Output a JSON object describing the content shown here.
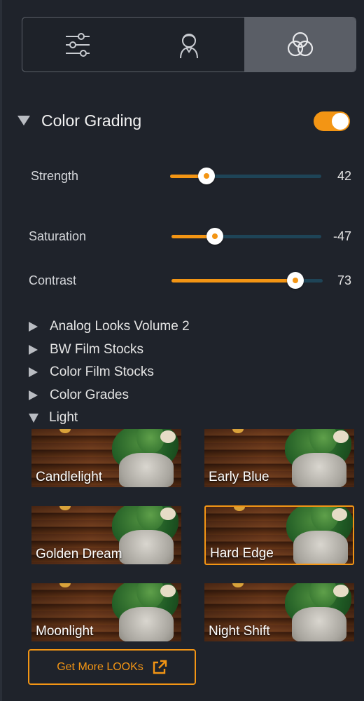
{
  "tabs": [
    {
      "icon": "sliders-icon",
      "active": false
    },
    {
      "icon": "portrait-icon",
      "active": false
    },
    {
      "icon": "color-circles-icon",
      "active": true
    }
  ],
  "section": {
    "title": "Color Grading",
    "enabled": true
  },
  "sliders": [
    {
      "label": "Strength",
      "value": "42",
      "fraction": 0.24
    },
    {
      "label": "Saturation",
      "value": "-47",
      "fraction": 0.29
    },
    {
      "label": "Contrast",
      "value": "73",
      "fraction": 0.82
    }
  ],
  "categories": [
    {
      "label": "Analog Looks Volume 2",
      "expanded": false
    },
    {
      "label": "BW Film Stocks",
      "expanded": false
    },
    {
      "label": "Color Film Stocks",
      "expanded": false
    },
    {
      "label": "Color Grades",
      "expanded": false
    },
    {
      "label": "Light",
      "expanded": true
    }
  ],
  "looks": [
    {
      "label": "Candlelight",
      "selected": false
    },
    {
      "label": "Early Blue",
      "selected": false
    },
    {
      "label": "Golden Dream",
      "selected": false
    },
    {
      "label": "Hard Edge",
      "selected": true
    },
    {
      "label": "Moonlight",
      "selected": false
    },
    {
      "label": "Night Shift",
      "selected": false
    }
  ],
  "get_more": {
    "label": "Get More LOOKs",
    "icon": "external-link-icon"
  },
  "colors": {
    "accent": "#f39514",
    "track": "#1e4457",
    "background": "#1f232b"
  }
}
